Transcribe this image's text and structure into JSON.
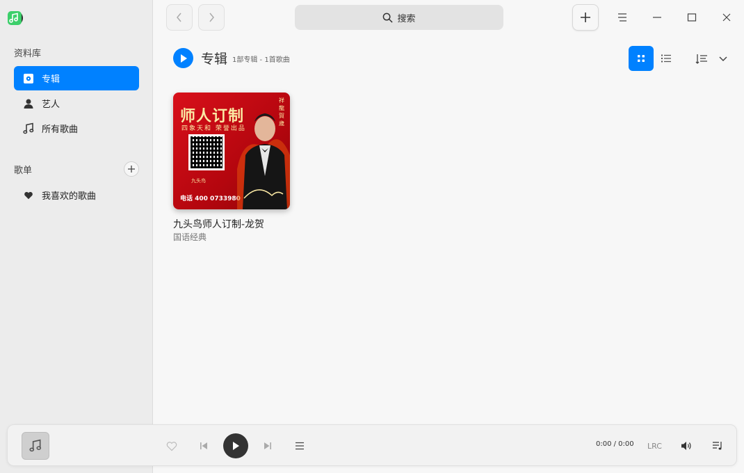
{
  "sidebar": {
    "library_title": "资料库",
    "items": [
      {
        "label": "专辑"
      },
      {
        "label": "艺人"
      },
      {
        "label": "所有歌曲"
      }
    ],
    "playlists_title": "歌单",
    "playlists": [
      {
        "label": "我喜欢的歌曲"
      }
    ]
  },
  "search": {
    "placeholder": "搜索"
  },
  "header": {
    "title": "专辑",
    "subtitle": "1部专辑 - 1首歌曲"
  },
  "albums": [
    {
      "name": "九头鸟师人订制-龙贺",
      "genre": "国语经典",
      "cover": {
        "title": "师人订制",
        "subtitle": "四象天和  荣誉出品",
        "phone": "电话 400 0733980",
        "vertical": "祥龍賀歲",
        "brand": "九头鸟"
      }
    }
  ],
  "player": {
    "time": "0:00 / 0:00",
    "lrc": "LRC"
  },
  "colors": {
    "accent": "#0081ff",
    "sidebar_bg": "#ececec",
    "cover_red": "#d8101a"
  }
}
